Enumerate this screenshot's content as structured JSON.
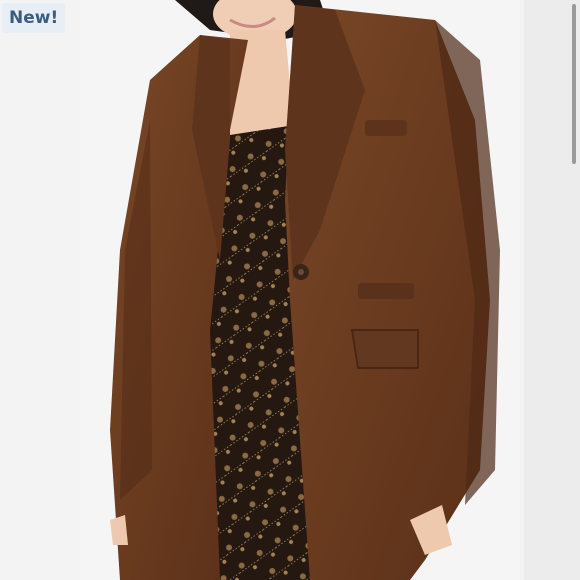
{
  "listing": {
    "badge_label": "New!",
    "image_icon": "product-photo",
    "colors": {
      "badge_bg": "#e7eef5",
      "badge_text": "#3c5e7c",
      "jacket": "#6e3f22",
      "dress": "#2a1d16",
      "background": "#f5f5f5"
    }
  }
}
